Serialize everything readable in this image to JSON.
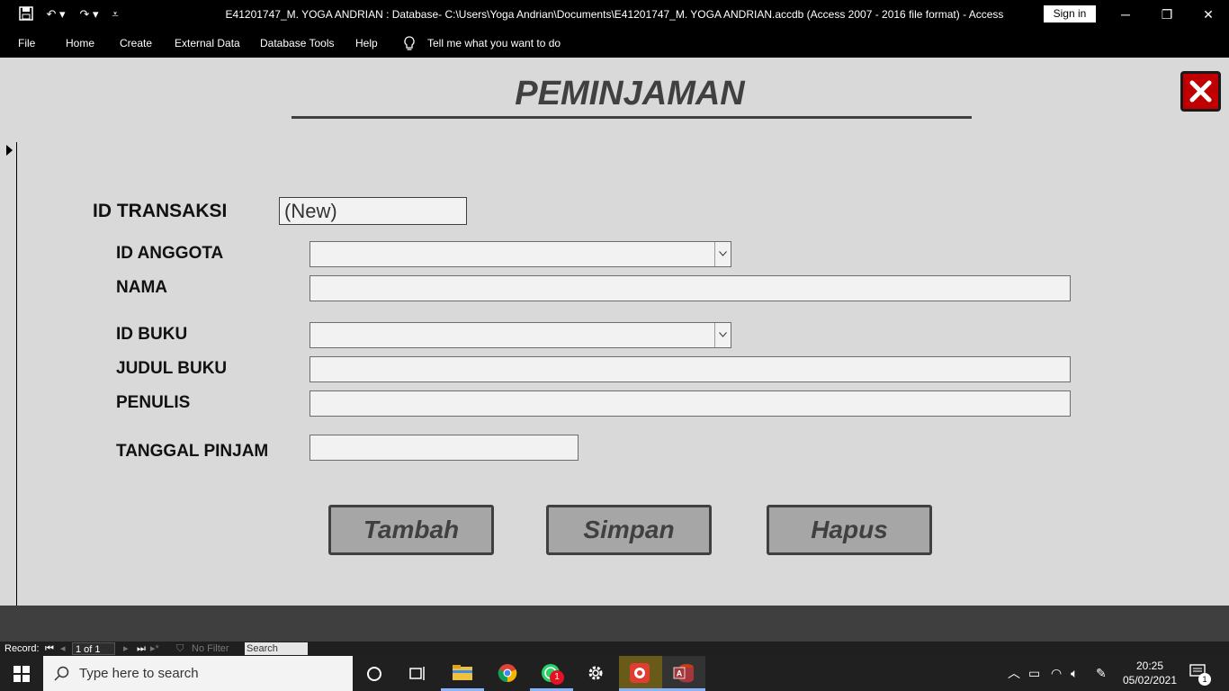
{
  "window": {
    "title": "E41201747_M. YOGA ANDRIAN : Database- C:\\Users\\Yoga Andrian\\Documents\\E41201747_M. YOGA ANDRIAN.accdb (Access 2007 - 2016 file format)  -  Access",
    "signin_label": "Sign in",
    "minimize": "─",
    "restore": "❐",
    "close": "✕"
  },
  "ribbon": {
    "tabs": [
      "File",
      "Home",
      "Create",
      "External Data",
      "Database Tools",
      "Help"
    ],
    "tell_me": "Tell me what you want to do"
  },
  "form": {
    "title": "PEMINJAMAN",
    "id_transaksi_label": "ID TRANSAKSI",
    "id_transaksi_value": "(New)",
    "id_anggota_label": "ID ANGGOTA",
    "nama_label": "NAMA",
    "id_buku_label": "ID BUKU",
    "judul_buku_label": "JUDUL BUKU",
    "penulis_label": "PENULIS",
    "tanggal_pinjam_label": "TANGGAL PINJAM",
    "id_anggota_value": "",
    "nama_value": "",
    "id_buku_value": "",
    "judul_buku_value": "",
    "penulis_value": "",
    "tanggal_pinjam_value": "",
    "buttons": {
      "tambah": "Tambah",
      "simpan": "Simpan",
      "hapus": "Hapus"
    }
  },
  "record_nav": {
    "label": "Record:",
    "current": "1 of 1",
    "filter": "No Filter",
    "search": "Search"
  },
  "taskbar": {
    "search_placeholder": "Type here to search",
    "whatsapp_badge": "1",
    "notification_badge": "1",
    "time": "20:25",
    "date": "05/02/2021"
  },
  "colors": {
    "form_background": "#d9d9d9",
    "button_fill": "#a6a6a6",
    "title_text": "#404040",
    "close_button": "#c00000"
  }
}
